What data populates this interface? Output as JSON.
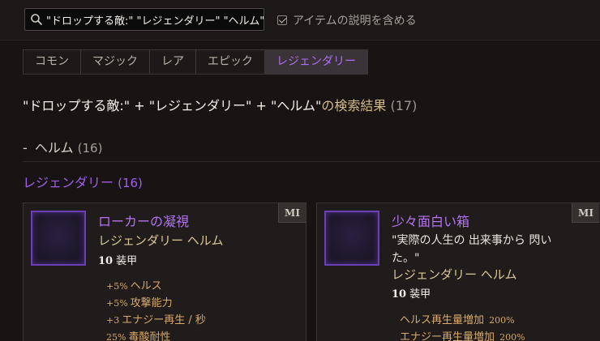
{
  "search": {
    "value": "\"ドロップする敵:\" \"レジェンダリー\" \"ヘルム\"",
    "icon": "search-icon"
  },
  "options": {
    "include_desc_label": "アイテムの説明を含める",
    "include_desc_checked": true
  },
  "tabs": [
    {
      "label": "コモン",
      "active": false
    },
    {
      "label": "マジック",
      "active": false
    },
    {
      "label": "レア",
      "active": false
    },
    {
      "label": "エピック",
      "active": false
    },
    {
      "label": "レジェンダリー",
      "active": true
    }
  ],
  "results": {
    "query": "\"ドロップする敵:\" + \"レジェンダリー\" + \"ヘルム\"",
    "suffix": "の検索結果",
    "count": "(17)"
  },
  "section": {
    "dash": "-",
    "title": "ヘルム",
    "count": "(16)"
  },
  "rarity_group": {
    "title": "レジェンダリー",
    "count": "(16)"
  },
  "cards": [
    {
      "badge": "MI",
      "name": "ローカーの凝視",
      "type": "レジェンダリー ヘルム",
      "armor_value": "10",
      "armor_label": "装甲",
      "stats": [
        {
          "prefix": "+5%",
          "text": "ヘルス"
        },
        {
          "prefix": "+5%",
          "text": "攻撃能力"
        },
        {
          "prefix": "+3",
          "text": "エナジー再生 / 秒"
        },
        {
          "prefix": "25%",
          "text": "毒酸耐性"
        }
      ]
    },
    {
      "badge": "MI",
      "name": "少々面白い箱",
      "quote": "\"実際の人生の 出来事から 閃いた。\"",
      "type": "レジェンダリー ヘルム",
      "armor_value": "10",
      "armor_label": "装甲",
      "stats": [
        {
          "text": "ヘルス再生量増加",
          "suffix": "200%"
        },
        {
          "text": "エナジー再生量増加",
          "suffix": "200%"
        }
      ]
    }
  ],
  "colors": {
    "background": "#171413",
    "legendary": "#b572f5",
    "stat": "#d9a968",
    "type": "#d9c697"
  }
}
